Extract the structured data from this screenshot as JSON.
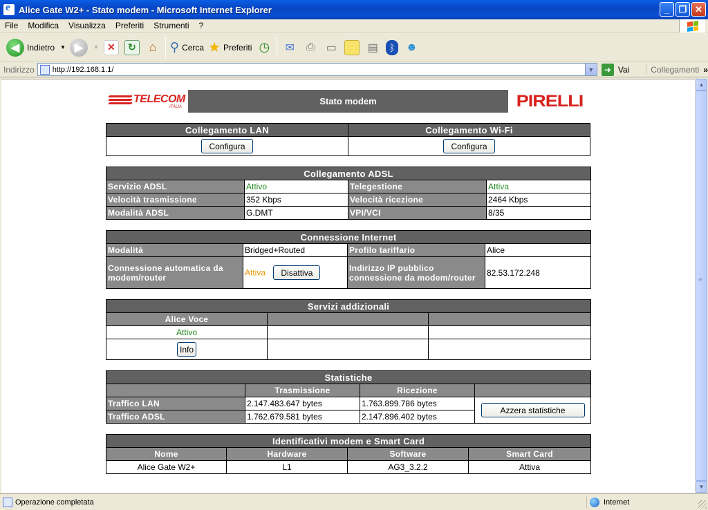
{
  "window": {
    "title": "Alice Gate W2+ - Stato modem - Microsoft Internet Explorer"
  },
  "menu": [
    "File",
    "Modifica",
    "Visualizza",
    "Preferiti",
    "Strumenti",
    "?"
  ],
  "toolbar": {
    "back": "Indietro",
    "search": "Cerca",
    "favorites": "Preferiti"
  },
  "address": {
    "label": "Indirizzo",
    "url": "http://192.168.1.1/",
    "go": "Vai",
    "links": "Collegamenti"
  },
  "page": {
    "title": "Stato modem",
    "logo_left": "TELECOM",
    "logo_left_sub": "ITALIA",
    "logo_right": "PIRELLI",
    "lan": {
      "title": "Collegamento LAN",
      "button": "Configura"
    },
    "wifi": {
      "title": "Collegamento Wi-Fi",
      "button": "Configura"
    },
    "adsl": {
      "title": "Collegamento ADSL",
      "rows": [
        {
          "l1": "Servizio ADSL",
          "v1": "Attivo",
          "l2": "Telegestione",
          "v2": "Attiva"
        },
        {
          "l1": "Velocità trasmissione",
          "v1": "352 Kbps",
          "l2": "Velocità ricezione",
          "v2": "2464 Kbps"
        },
        {
          "l1": "Modalità ADSL",
          "v1": "G.DMT",
          "l2": "VPI/VCI",
          "v2": "8/35"
        }
      ]
    },
    "internet": {
      "title": "Connessione Internet",
      "mode_label": "Modalità",
      "mode_value": "Bridged+Routed",
      "profile_label": "Profilo tariffario",
      "profile_value": "Alice",
      "auto_label": "Connessione automatica da modem/router",
      "auto_value": "Attiva",
      "auto_button": "Disattiva",
      "ip_label": "Indirizzo IP pubblico connessione da modem/router",
      "ip_value": "82.53.172.248"
    },
    "services": {
      "title": "Servizi addizionali",
      "col1": "Alice Voce",
      "status": "Attivo",
      "button": "Info"
    },
    "stats": {
      "title": "Statistiche",
      "tx": "Trasmissione",
      "rx": "Ricezione",
      "lan_label": "Traffico LAN",
      "lan_tx": "2.147.483.647 bytes",
      "lan_rx": "1.763.899.786 bytes",
      "adsl_label": "Traffico ADSL",
      "adsl_tx": "1.762.679.581 bytes",
      "adsl_rx": "2.147.896.402 bytes",
      "reset": "Azzera statistiche"
    },
    "ids": {
      "title": "Identificativi modem e Smart Card",
      "headers": [
        "Nome",
        "Hardware",
        "Software",
        "Smart Card"
      ],
      "values": [
        "Alice Gate W2+",
        "L1",
        "AG3_3.2.2",
        "Attiva"
      ]
    }
  },
  "status": {
    "text": "Operazione completata",
    "zone": "Internet"
  }
}
